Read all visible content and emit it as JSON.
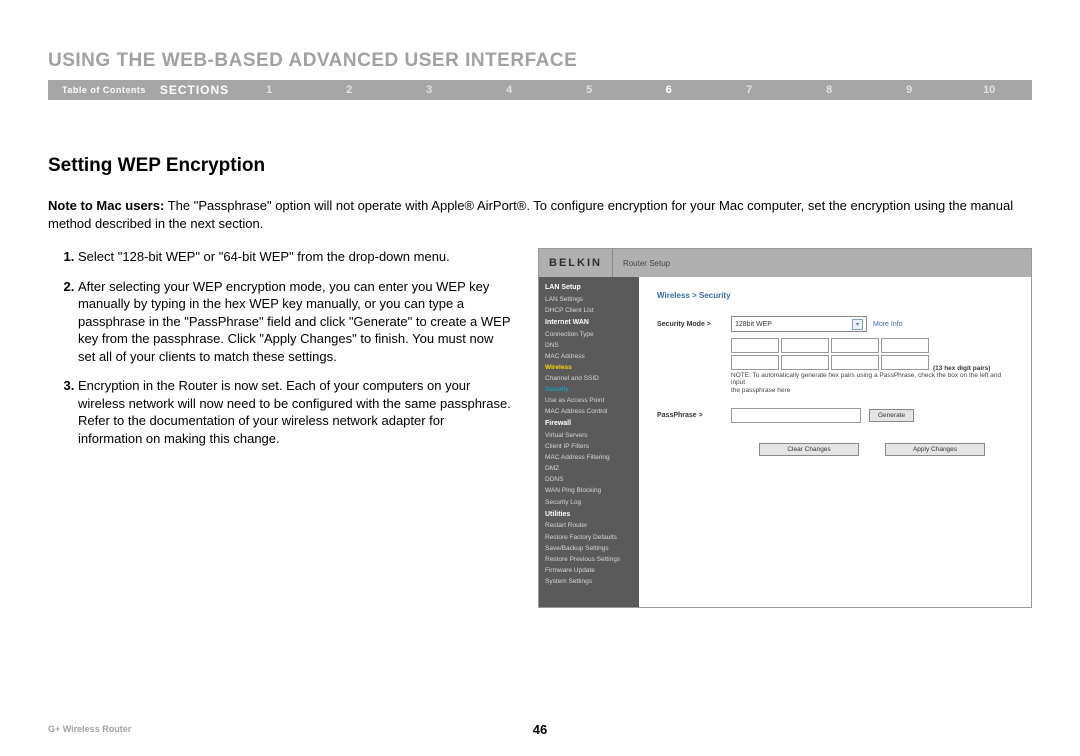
{
  "header": {
    "title": "USING THE WEB-BASED ADVANCED USER INTERFACE",
    "toc": "Table of Contents",
    "sections_label": "SECTIONS",
    "sections": [
      "1",
      "2",
      "3",
      "4",
      "5",
      "6",
      "7",
      "8",
      "9",
      "10"
    ],
    "active_section": "6"
  },
  "subsection_title": "Setting WEP Encryption",
  "note": {
    "bold": "Note to Mac users:",
    "text": " The \"Passphrase\" option will not operate with Apple® AirPort®. To configure encryption for your Mac computer, set the encryption using the manual method described in the next section."
  },
  "steps": [
    "Select \"128-bit WEP\" or \"64-bit WEP\" from the drop-down menu.",
    "After selecting your WEP encryption mode, you can enter you WEP key manually by typing in the hex WEP key manually, or you can type a passphrase in the \"PassPhrase\" field and click \"Generate\" to create a WEP key from the passphrase. Click \"Apply Changes\" to finish. You must now set all of your clients to match these settings.",
    "Encryption in the Router is now set. Each of your computers on your wireless network will now need to be configured with the same passphrase. Refer to the documentation of your wireless network adapter for information on making this change."
  ],
  "router": {
    "logo": "BELKIN",
    "header_title": "Router Setup",
    "sidebar": [
      {
        "type": "cat",
        "label": "LAN Setup"
      },
      {
        "type": "item",
        "label": "LAN Settings"
      },
      {
        "type": "item",
        "label": "DHCP Client List"
      },
      {
        "type": "cat",
        "label": "Internet WAN"
      },
      {
        "type": "item",
        "label": "Connection Type"
      },
      {
        "type": "item",
        "label": "DNS"
      },
      {
        "type": "item",
        "label": "MAC Address"
      },
      {
        "type": "active-cat",
        "label": "Wireless"
      },
      {
        "type": "item",
        "label": "Channel and SSID"
      },
      {
        "type": "active-item",
        "label": "Security"
      },
      {
        "type": "item",
        "label": "Use as Access Point"
      },
      {
        "type": "item",
        "label": "MAC Address Control"
      },
      {
        "type": "cat",
        "label": "Firewall"
      },
      {
        "type": "item",
        "label": "Virtual Servers"
      },
      {
        "type": "item",
        "label": "Client IP Filters"
      },
      {
        "type": "item",
        "label": "MAC Address Filtering"
      },
      {
        "type": "item",
        "label": "DMZ"
      },
      {
        "type": "item",
        "label": "DDNS"
      },
      {
        "type": "item",
        "label": "WAN Ping Blocking"
      },
      {
        "type": "item",
        "label": "Security Log"
      },
      {
        "type": "cat",
        "label": "Utilities"
      },
      {
        "type": "item",
        "label": "Restart Router"
      },
      {
        "type": "item",
        "label": "Restore Factory Defaults"
      },
      {
        "type": "item",
        "label": "Save/Backup Settings"
      },
      {
        "type": "item",
        "label": "Restore Previous Settings"
      },
      {
        "type": "item",
        "label": "Firmware Update"
      },
      {
        "type": "item",
        "label": "System Settings"
      }
    ],
    "breadcrumb": "Wireless > Security",
    "security_mode_label": "Security Mode >",
    "security_mode_value": "128bit WEP",
    "more_info": "More Info",
    "hex_pairs_label": "(13 hex digit pairs)",
    "hex_note1": "NOTE: To automatically generate hex pairs using a PassPhrase, check the box on the left and input",
    "hex_note2": "the passphrase here",
    "passphrase_label": "PassPhrase >",
    "generate_btn": "Generate",
    "clear_btn": "Clear Changes",
    "apply_btn": "Apply Changes"
  },
  "footer": {
    "product": "G+ Wireless Router",
    "page": "46"
  }
}
